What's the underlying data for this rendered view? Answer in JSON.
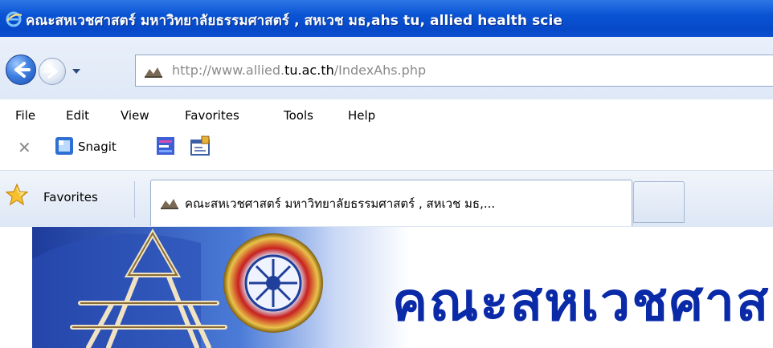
{
  "window": {
    "title": "คณะสหเวชศาสตร์ มหาวิทยาลัยธรรมศาสตร์ , สหเวช มธ,ahs tu, allied health scie"
  },
  "address_bar": {
    "url_prefix": "http://www.allied.",
    "url_domain": "tu.ac.th",
    "url_path": "/IndexAhs.php"
  },
  "menu": {
    "items": [
      "File",
      "Edit",
      "View",
      "Favorites",
      "Tools",
      "Help"
    ]
  },
  "command_bar": {
    "snagit_label": "Snagit"
  },
  "favorites_bar": {
    "favorites_label": "Favorites",
    "active_tab_title": "คณะสหเวชศาสตร์ มหาวิทยาลัยธรรมศาสตร์ , สหเวช มธ,..."
  },
  "page": {
    "banner_title": "คณะสหเวชศาส"
  },
  "colors": {
    "titlebar": "#0a55d4",
    "banner_text": "#0a2aa8"
  }
}
